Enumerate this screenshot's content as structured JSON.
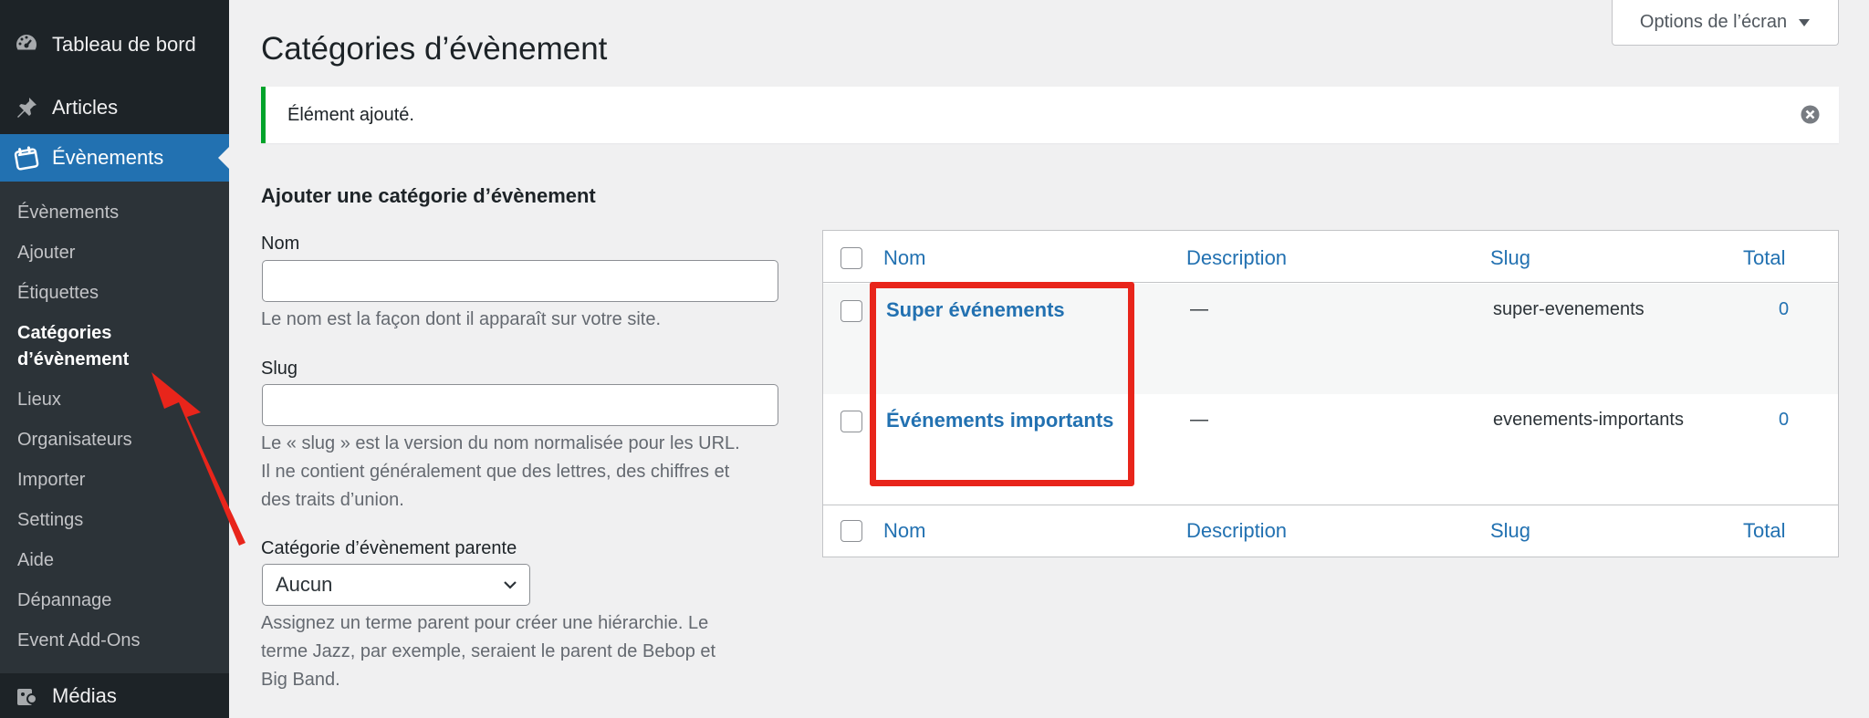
{
  "sidebar": {
    "top_items": [
      {
        "label": "Tableau de bord",
        "icon": "dashboard-icon"
      },
      {
        "label": "Articles",
        "icon": "pushpin-icon"
      },
      {
        "label": "Évènements",
        "icon": "calendar-icon",
        "current": true
      }
    ],
    "submenu": [
      {
        "label": "Évènements"
      },
      {
        "label": "Ajouter"
      },
      {
        "label": "Étiquettes"
      },
      {
        "label": "Catégories d’évènement",
        "current": true
      },
      {
        "label": "Lieux"
      },
      {
        "label": "Organisateurs"
      },
      {
        "label": "Importer"
      },
      {
        "label": "Settings"
      },
      {
        "label": "Aide"
      },
      {
        "label": "Dépannage"
      },
      {
        "label": "Event Add-Ons"
      }
    ],
    "bottom_item": {
      "label": "Médias",
      "icon": "media-icon"
    }
  },
  "screen_options": {
    "label": "Options de l’écran"
  },
  "page": {
    "title": "Catégories d’évènement"
  },
  "notice": {
    "message": "Élément ajouté."
  },
  "form": {
    "heading": "Ajouter une catégorie d’évènement",
    "name_label": "Nom",
    "name_value": "",
    "name_help": "Le nom est la façon dont il apparaît sur votre site.",
    "slug_label": "Slug",
    "slug_value": "",
    "slug_help": [
      "Le « slug » est la version du nom normalisée pour les URL.",
      "Il ne contient généralement que des lettres, des chiffres et",
      "des traits d’union."
    ],
    "parent_label": "Catégorie d’évènement parente",
    "parent_selected": "Aucun",
    "parent_help": [
      "Assignez un terme parent pour créer une hiérarchie. Le",
      "terme Jazz, par exemple, seraient le parent de Bebop et",
      "Big Band."
    ]
  },
  "table": {
    "columns": {
      "name": "Nom",
      "description": "Description",
      "slug": "Slug",
      "total": "Total"
    },
    "rows": [
      {
        "name": "Super événements",
        "description": "—",
        "slug": "super-evenements",
        "total": "0"
      },
      {
        "name": "Événements importants",
        "description": "—",
        "slug": "evenements-importants",
        "total": "0"
      }
    ]
  },
  "colors": {
    "admin_dark": "#1d2327",
    "submenu_bg": "#2c3338",
    "accent_blue": "#2271b1",
    "success_green": "#00a32a",
    "annotation_red": "#e8251b"
  }
}
